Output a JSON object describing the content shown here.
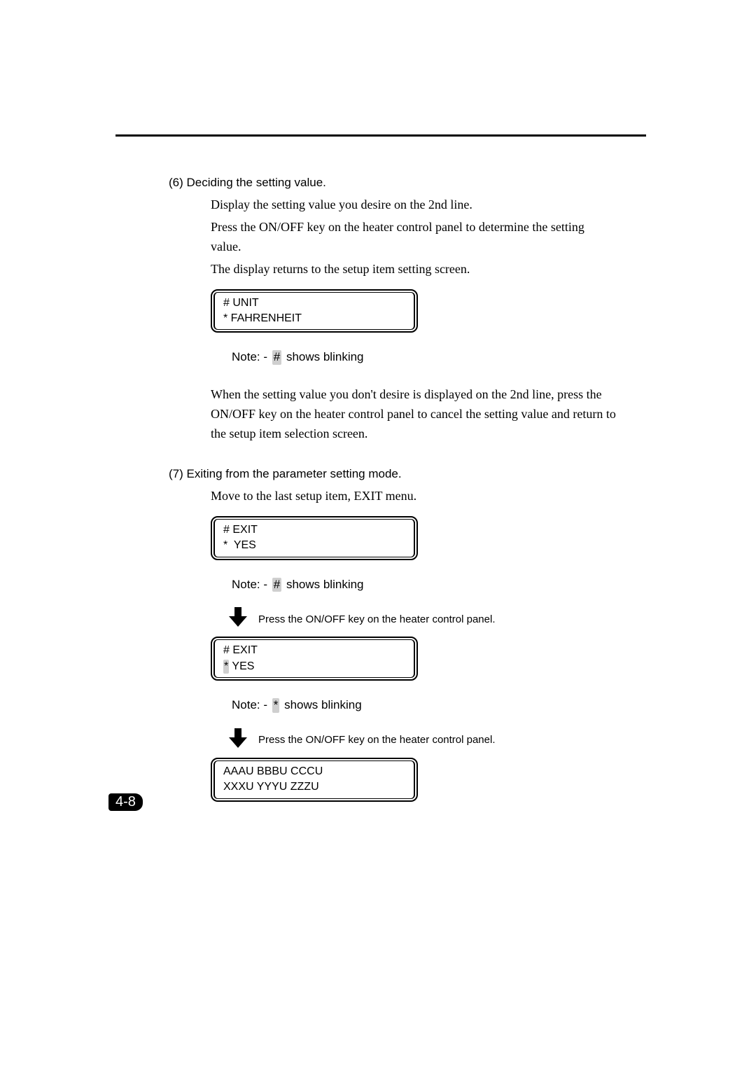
{
  "page_number": "4-8",
  "steps": {
    "six": {
      "title": "(6) Deciding the setting value.",
      "lines": [
        "Display the setting value you desire on the 2nd line.",
        "Press the ON/OFF key on the heater control panel to determine the setting value.",
        "The display returns to the setup item setting screen."
      ],
      "lcd": {
        "line1": "# UNIT",
        "line2": "* FAHRENHEIT"
      },
      "note_prefix": "Note:  -  ",
      "note_symbol": "#",
      "note_suffix": "  shows blinking",
      "below": "When the setting value you don't desire is displayed on the 2nd line, press the ON/OFF key on the heater control panel to cancel the setting value and return to the setup item selection screen."
    },
    "seven": {
      "title": "(7) Exiting from the parameter setting mode.",
      "lines": [
        "Move to the last setup item, EXIT menu."
      ],
      "lcd1": {
        "line1": "# EXIT",
        "line2": "*  YES"
      },
      "note1_symbol": "#",
      "arrow_caption": "Press the ON/OFF key on the heater control panel.",
      "lcd2": {
        "line1": "# EXIT",
        "line2_symbol": "*",
        "line2_rest": " YES"
      },
      "note2_symbol": "*",
      "lcd3": {
        "line1": "AAAU BBBU CCCU",
        "line2": "XXXU YYYU ZZZU"
      }
    }
  }
}
